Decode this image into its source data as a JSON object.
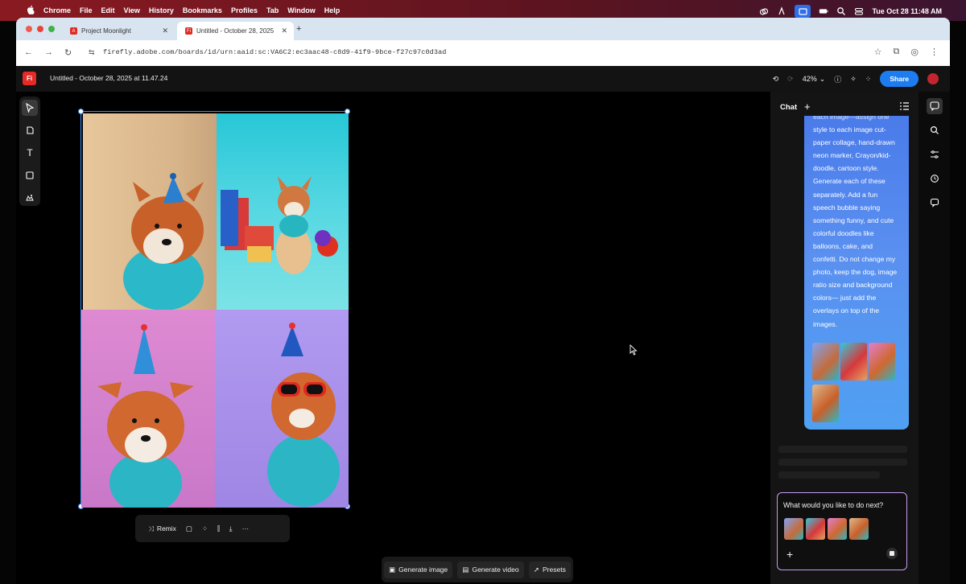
{
  "menubar": {
    "app": "Chrome",
    "menus": [
      "File",
      "Edit",
      "View",
      "History",
      "Bookmarks",
      "Profiles",
      "Tab",
      "Window",
      "Help"
    ],
    "clock": "Tue Oct 28  11:48 AM"
  },
  "browser": {
    "tabs": [
      {
        "title": "Project Moonlight"
      },
      {
        "title": "Untitled - October 28, 2025"
      }
    ],
    "url": "firefly.adobe.com/boards/id/urn:aaid:sc:VA6C2:ec3aac48-c8d9-41f9-9bce-f27c97c0d3ad"
  },
  "app": {
    "logo": "Fi",
    "doc_title": "Untitled - October 28, 2025 at 11.47.24",
    "zoom": "42%",
    "share_label": "Share"
  },
  "selection_toolbar": {
    "remix_label": "Remix"
  },
  "bottom_toolbar": {
    "generate_image": "Generate image",
    "generate_video": "Generate video",
    "presets": "Presets"
  },
  "chat": {
    "title": "Chat",
    "message_lines": [
      "each image—assign one",
      "style to each image cut-",
      "paper collage, hand-drawn",
      "neon marker, Crayon/kid-",
      "doodle, cartoon style.",
      "Generate each of these",
      "separately. Add a fun",
      "speech bubble saying",
      "something funny, and cute",
      "colorful doodles like",
      "balloons, cake, and",
      "confetti. Do not change my",
      "photo, keep the dog, image",
      "ratio size and background",
      "colors— just add the",
      "overlays on top of the",
      "images."
    ],
    "input_placeholder": "What would you like to do next?"
  },
  "colors": {
    "accent": "#1d7df0",
    "brand_red": "#e42b28",
    "chat_bubble": "#4f8ef0",
    "input_border": "#c79cf1"
  }
}
